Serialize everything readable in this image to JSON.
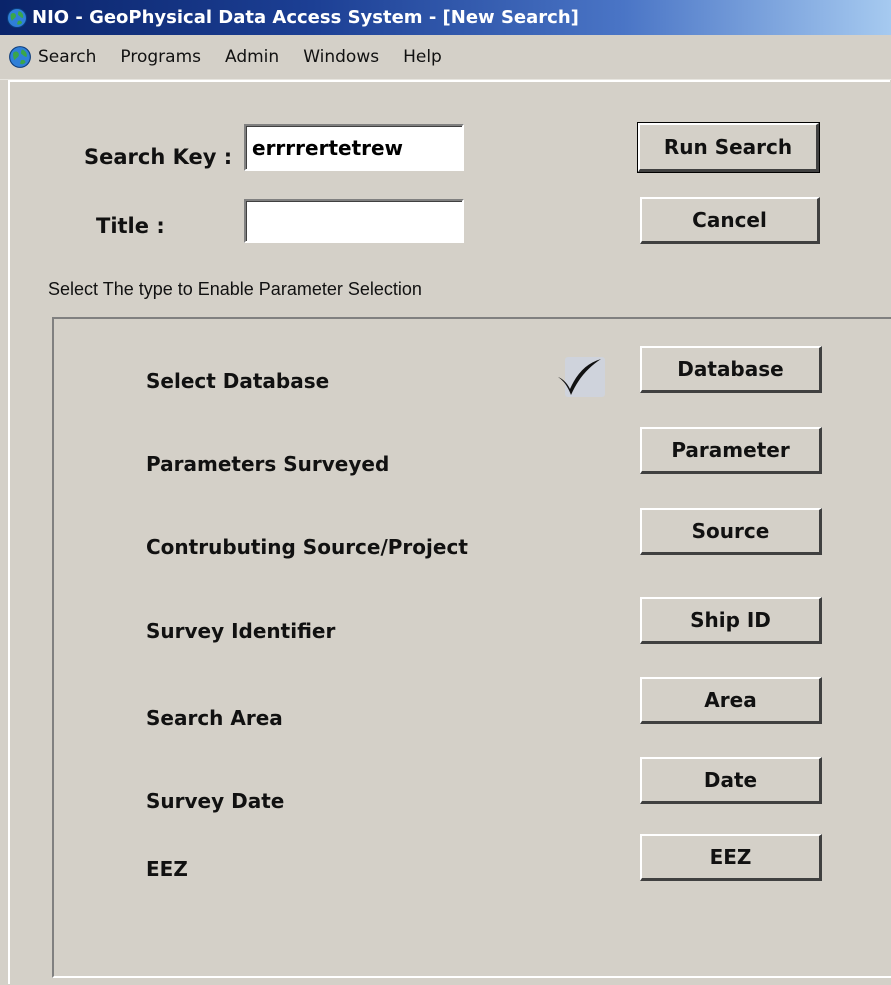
{
  "window": {
    "title": "NIO - GeoPhysical Data Access System - [New Search]",
    "title_icon": "globe-icon"
  },
  "menubar": {
    "icon": "globe-icon",
    "items": [
      "Search",
      "Programs",
      "Admin",
      "Windows",
      "Help"
    ]
  },
  "form": {
    "search_key_label": "Search Key :",
    "search_key_value": "errrrertetrew",
    "title_label": "Title :",
    "title_value": "",
    "run_search_label": "Run Search",
    "cancel_label": "Cancel",
    "hint": "Select The type to Enable Parameter Selection"
  },
  "params": {
    "rows": [
      {
        "label": "Select Database",
        "button": "Database",
        "checked": true
      },
      {
        "label": "Parameters Surveyed",
        "button": "Parameter",
        "checked": false
      },
      {
        "label": "Contrubuting Source/Project",
        "button": "Source",
        "checked": false
      },
      {
        "label": "Survey Identifier",
        "button": "Ship ID",
        "checked": false
      },
      {
        "label": "Search Area",
        "button": "Area",
        "checked": false
      },
      {
        "label": "Survey Date",
        "button": "Date",
        "checked": false
      },
      {
        "label": "EEZ",
        "button": "EEZ",
        "checked": false
      }
    ],
    "check_icon": "checkmark-icon"
  },
  "colors": {
    "titlebar_start": "#0a246a",
    "titlebar_end": "#a6caf0",
    "face": "#d4d0c8"
  }
}
